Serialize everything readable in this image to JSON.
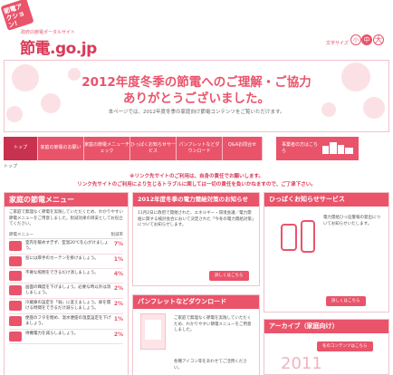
{
  "header": {
    "flag_text": "節電アクション!",
    "tagline": "政府の節電ポータルサイト",
    "logo": "節電.go.jp",
    "font_size_label": "文字サイズ",
    "font_sizes": [
      "小",
      "中",
      "大"
    ]
  },
  "hero": {
    "line1": "2012年度冬季の節電へのご理解・ご協力",
    "line2": "ありがとうございました。",
    "sub": "本ページでは、2012年度冬季の家庭向け節電コンテンツをご覧いただけます。"
  },
  "nav": {
    "items": [
      "トップ",
      "家庭の節電のお願い",
      "家庭の節電メニューチェック",
      "ひっぱくお知らせサービス",
      "パンフレットなどダウンロード",
      "Q&Aお問合せ"
    ],
    "business": "事業者の方はこちら"
  },
  "breadcrumb": "トップ",
  "notice": {
    "line1": "※リンク先サイトのご利用は、自身の責任でお願いします。",
    "line2": "リンク先サイトのご利用により生じるトラブルに関しては一切の責任を負いかねますので、ご了承下さい。"
  },
  "menu": {
    "title": "家庭の節電メニュー",
    "intro": "ご家庭で無理なく節電を実践していただくため、わかりやすい節電メニューをご用意しました。削減効果の目安としてお役立てください。",
    "col_label": "節電メニュー",
    "col_effect": "削減率",
    "tips": [
      {
        "text": "室内を暖めすぎず、室温20℃を心がけましょう。",
        "pct": "7%"
      },
      {
        "text": "窓には厚手のカーテンを掛けましょう。",
        "pct": "1%"
      },
      {
        "text": "不要な照明をできるだけ消しましょう。",
        "pct": "4%"
      },
      {
        "text": "画面の輝度を下げましょう。必要な時以外は消しましょう。",
        "pct": "2%"
      },
      {
        "text": "冷蔵庫の設定を「弱」に変えましょう。扉を開ける時間をできるだけ減らしましょう。",
        "pct": "2%"
      },
      {
        "text": "便座のフタを閉め、温水便座の温度設定を下げましょう。",
        "pct": "1%"
      },
      {
        "text": "待機電力を減らしましょう。",
        "pct": "2%"
      }
    ]
  },
  "forecast": {
    "title": "2012年度冬季の電力需給対策のお知らせ",
    "body": "11月2日に政府で開催された、エネルギー・環境会議／電力需給に関する検討会合において決定された「今冬の電力需給対策」についてお知らせします。",
    "button": "詳しくはこちら"
  },
  "alert_service": {
    "title": "ひっぱくお知らせサービス",
    "body": "電力需給ひっ迫警報の発出についてお知らせいたします。",
    "button": "詳しくはこちら"
  },
  "pamphlet": {
    "title": "パンフレットなどダウンロード",
    "body": "ご家庭で無理なく節電を実践していただくため、わかりやすい節電メニューをご用意しました。",
    "note": "各種アイコン等をあわせてご活用ください。"
  },
  "archive": {
    "title": "アーカイブ（家庭向け）",
    "year": "2011",
    "button": "冬のコンテンツはこちら"
  }
}
